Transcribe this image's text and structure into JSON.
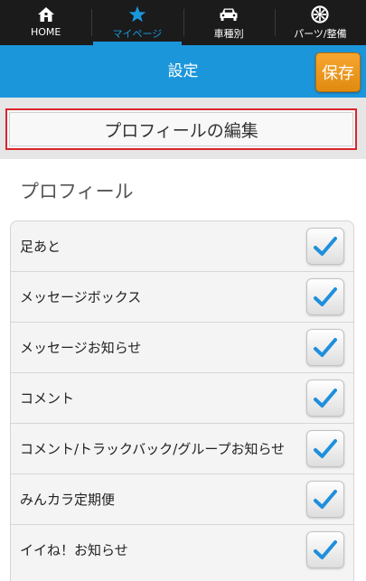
{
  "nav": {
    "items": [
      {
        "label": "HOME",
        "icon": "home-icon"
      },
      {
        "label": "マイページ",
        "icon": "star-icon",
        "active": true
      },
      {
        "label": "車種別",
        "icon": "car-icon"
      },
      {
        "label": "パーツ/整備",
        "icon": "wheel-icon"
      }
    ]
  },
  "header": {
    "title": "設定",
    "save_label": "保存"
  },
  "profile": {
    "edit_label": "プロフィールの編集",
    "section_title": "プロフィール"
  },
  "settings": {
    "items": [
      {
        "label": "足あと",
        "checked": true
      },
      {
        "label": "メッセージボックス",
        "checked": true
      },
      {
        "label": "メッセージお知らせ",
        "checked": true
      },
      {
        "label": "コメント",
        "checked": true
      },
      {
        "label": "コメント/トラックバック/グループお知らせ",
        "checked": true
      },
      {
        "label": "みんカラ定期便",
        "checked": true
      },
      {
        "label": "イイね！お知らせ",
        "checked": true
      }
    ]
  },
  "colors": {
    "accent": "#1c96db",
    "save": "#f39a1f",
    "highlight": "#d9262d",
    "check": "#1e8fdc"
  }
}
